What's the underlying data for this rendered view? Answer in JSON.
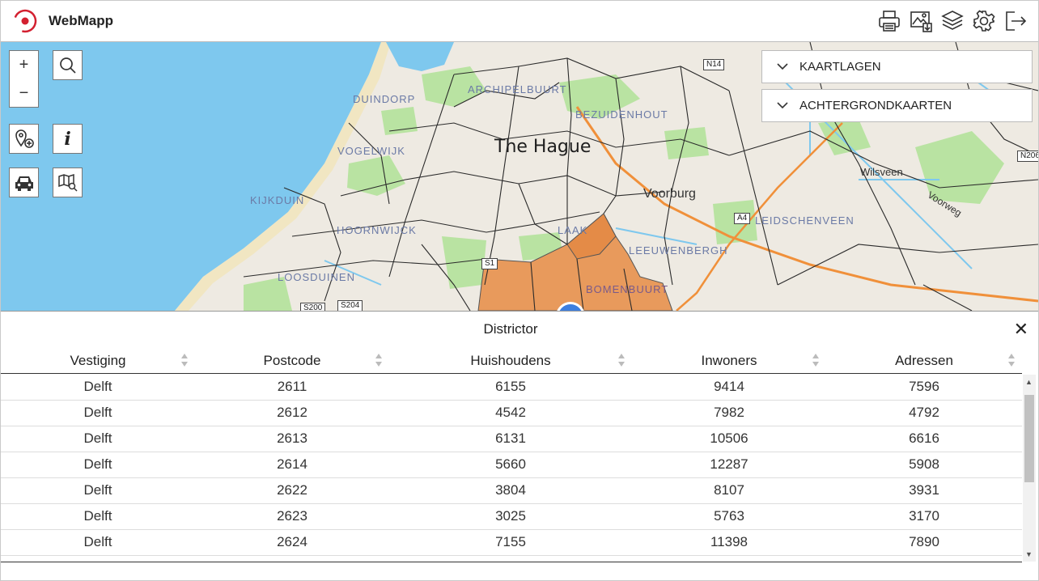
{
  "app": {
    "title": "WebMapp"
  },
  "toolbar": {
    "icons": [
      "printer-icon",
      "map-export-icon",
      "layers-icon",
      "settings-icon",
      "logout-icon"
    ]
  },
  "map": {
    "labels": {
      "archipelbuurt": "ARCHIPELBUURT",
      "duindorp": "DUINDORP",
      "bezuidenhout": "BEZUIDENHOUT",
      "vogelwijk": "VOGELWIJK",
      "kijkduin": "KIJKDUIN",
      "loosduinen": "LOOSDUINEN",
      "leidschenveen": "LEIDSCHENVEEN",
      "leeuwenbergh": "LEEUWENBERGH",
      "hoornwijck": "HOORNWIJCK",
      "laak": "LAAK",
      "bomenbuurt": "BOMENBUURT",
      "wilsveen": "Wilsveen",
      "voorweg": "Voorweg"
    },
    "city": "The Hague",
    "town": "Voorburg",
    "shields": {
      "n14": "N14",
      "a4": "A4",
      "s200": "S200",
      "s204": "S204",
      "s1": "S1",
      "n206": "N206"
    }
  },
  "controls": {
    "zoom_in": "+",
    "zoom_out": "−",
    "info": "i"
  },
  "panels": {
    "kaartlagen": "KAARTLAGEN",
    "achtergrondkaarten": "ACHTERGRONDKAARTEN"
  },
  "districtor": {
    "title": "Districtor",
    "close": "✕",
    "columns": [
      "Vestiging",
      "Postcode",
      "Huishoudens",
      "Inwoners",
      "Adressen"
    ],
    "rows": [
      [
        "Delft",
        "2611",
        "6155",
        "9414",
        "7596"
      ],
      [
        "Delft",
        "2612",
        "4542",
        "7982",
        "4792"
      ],
      [
        "Delft",
        "2613",
        "6131",
        "10506",
        "6616"
      ],
      [
        "Delft",
        "2614",
        "5660",
        "12287",
        "5908"
      ],
      [
        "Delft",
        "2622",
        "3804",
        "8107",
        "3931"
      ],
      [
        "Delft",
        "2623",
        "3025",
        "5763",
        "3170"
      ],
      [
        "Delft",
        "2624",
        "7155",
        "11398",
        "7890"
      ]
    ]
  },
  "colors": {
    "sea": "#7ec8ee",
    "land": "#eeeae2",
    "park": "#b9e3a2",
    "district_fill": "#e89a5c",
    "highway": "#f0903a"
  }
}
